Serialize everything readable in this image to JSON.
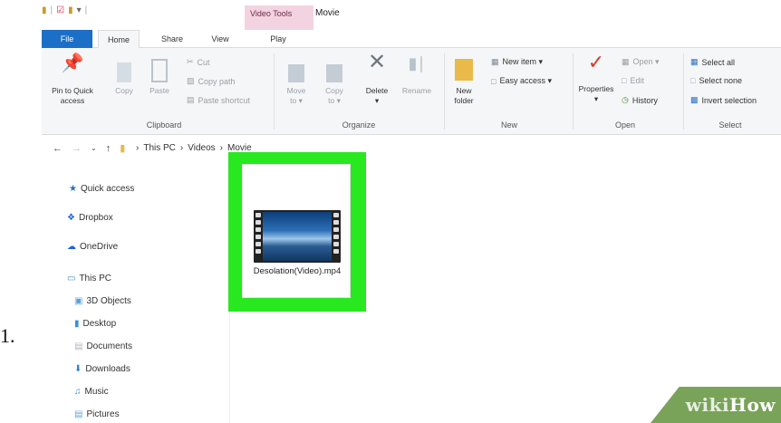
{
  "step": {
    "number": "1."
  },
  "title_bar": {
    "contextual_tab": "Video Tools",
    "title": "Movie"
  },
  "tabs": [
    {
      "label": "File"
    },
    {
      "label": "Home"
    },
    {
      "label": "Share"
    },
    {
      "label": "View"
    },
    {
      "label": "Play"
    }
  ],
  "ribbon": {
    "clipboard": {
      "pin_label_1": "Pin to Quick",
      "pin_label_2": "access",
      "copy": "Copy",
      "paste": "Paste",
      "cut": "Cut",
      "copy_path": "Copy path",
      "paste_shortcut": "Paste shortcut",
      "group": "Clipboard"
    },
    "organize": {
      "move_to_1": "Move",
      "move_to_2": "to ▾",
      "copy_to_1": "Copy",
      "copy_to_2": "to ▾",
      "delete": "Delete",
      "delete_arrow": "▾",
      "rename": "Rename",
      "group": "Organize"
    },
    "new": {
      "new_folder_1": "New",
      "new_folder_2": "folder",
      "new_item": "New item ▾",
      "easy_access": "Easy access ▾",
      "group": "New"
    },
    "open": {
      "properties": "Properties",
      "properties_arrow": "▾",
      "open": "Open ▾",
      "edit": "Edit",
      "history": "History",
      "group": "Open"
    },
    "select": {
      "select_all": "Select all",
      "select_none": "Select none",
      "invert": "Invert selection",
      "group": "Select"
    }
  },
  "address": {
    "crumbs": [
      "This PC",
      "Videos",
      "Movie"
    ],
    "sep": "›"
  },
  "nav_pane": [
    {
      "label": "Quick access",
      "icon": "star-icon"
    },
    {
      "label": "Dropbox",
      "icon": "dropbox-icon"
    },
    {
      "label": "OneDrive",
      "icon": "cloud-icon"
    },
    {
      "label": "This PC",
      "icon": "computer-icon"
    },
    {
      "label": "3D Objects",
      "icon": "cube-icon"
    },
    {
      "label": "Desktop",
      "icon": "desktop-folder-icon"
    },
    {
      "label": "Documents",
      "icon": "documents-folder-icon"
    },
    {
      "label": "Downloads",
      "icon": "downloads-folder-icon"
    },
    {
      "label": "Music",
      "icon": "music-folder-icon"
    },
    {
      "label": "Pictures",
      "icon": "pictures-folder-icon"
    }
  ],
  "file": {
    "name": "Desolation(Video).mp4"
  },
  "watermark": {
    "part1": "wiki",
    "part2": "How"
  },
  "colors": {
    "highlight": "#28e81f",
    "file_tab": "#1c6fc6",
    "video_tools_tab": "#f4d3e0",
    "watermark": "#7aa35a"
  }
}
